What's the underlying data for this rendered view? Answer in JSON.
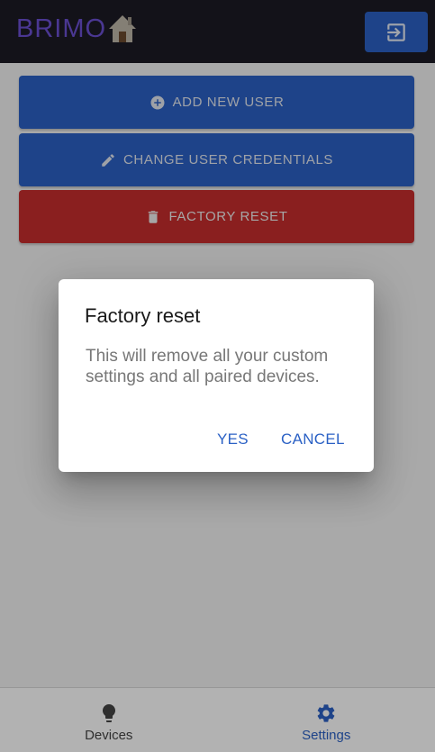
{
  "app": {
    "logo_text": "BRIMO"
  },
  "actions": {
    "add_user": "ADD NEW USER",
    "change_credentials": "CHANGE USER CREDENTIALS",
    "factory_reset": "FACTORY RESET"
  },
  "dialog": {
    "title": "Factory reset",
    "message": "This will remove all your custom settings and all paired devices.",
    "yes_label": "YES",
    "cancel_label": "CANCEL"
  },
  "bottom_nav": {
    "items": [
      {
        "label": "Devices",
        "icon": "lightbulb-icon",
        "active": false
      },
      {
        "label": "Settings",
        "icon": "gear-icon",
        "active": true
      }
    ]
  },
  "colors": {
    "primary": "#2b61c5",
    "danger": "#c62d2d",
    "app_bar": "#1c1a24",
    "logo": "#6a4fd1"
  },
  "icons": {
    "logout": "logout-icon",
    "add": "add-circle-icon",
    "edit": "pencil-icon",
    "delete": "trash-icon",
    "logo": "house-icon"
  }
}
